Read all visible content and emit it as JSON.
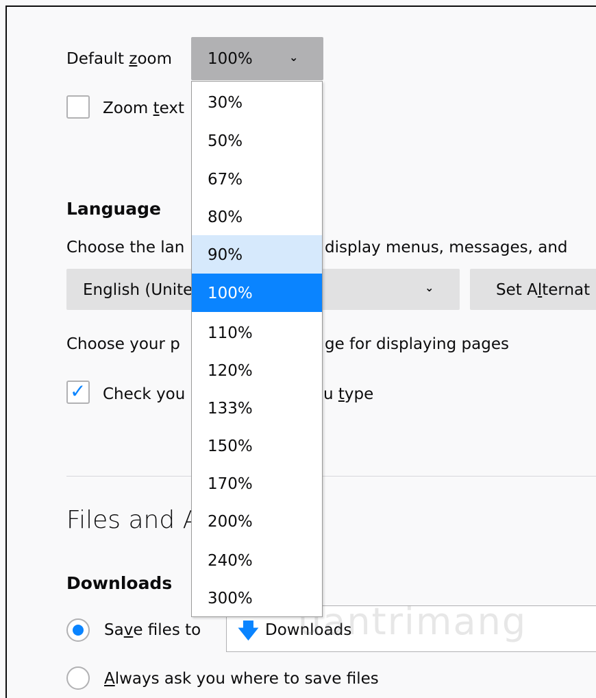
{
  "zoom": {
    "label_prefix": "Default ",
    "label_u": "z",
    "label_suffix": "oom",
    "selected": "100%",
    "zoom_text_prefix": "Zoom ",
    "zoom_text_u": "t",
    "zoom_text_suffix": "ext",
    "options": [
      "30%",
      "50%",
      "67%",
      "80%",
      "90%",
      "100%",
      "110%",
      "120%",
      "133%",
      "150%",
      "170%",
      "200%",
      "240%",
      "300%"
    ],
    "hovered": "90%",
    "highlighted": "100%"
  },
  "language": {
    "heading": "Language",
    "desc_left": "Choose the lan",
    "desc_right": "display menus, messages, and",
    "select_value": "English (Unite",
    "alt_button_prefix": "Set A",
    "alt_button_u": "l",
    "alt_button_suffix": "ternat",
    "pref_left": "Choose your p",
    "pref_right": "ge for displaying pages",
    "spell_left": "Check you",
    "spell_right": "u ",
    "spell_u": "t",
    "spell_suffix": "ype",
    "spell_checked": true
  },
  "files": {
    "section_title": "Files and A",
    "downloads_heading": "Downloads",
    "save_prefix": "Sa",
    "save_u": "v",
    "save_suffix": "e files to",
    "folder_name": "Downloads",
    "always_ask_u": "A",
    "always_ask_suffix": "lways ask you where to save files",
    "save_selected": true
  },
  "icons": {
    "chevron": "chevron-down-icon",
    "download": "download-arrow-icon",
    "check": "checkmark-icon"
  },
  "colors": {
    "accent": "#0a84ff",
    "hover": "#d6e9fc",
    "select_bg": "#e1e1e2",
    "zoom_button_bg": "#b1b1b3"
  },
  "watermark": "uantrimang"
}
